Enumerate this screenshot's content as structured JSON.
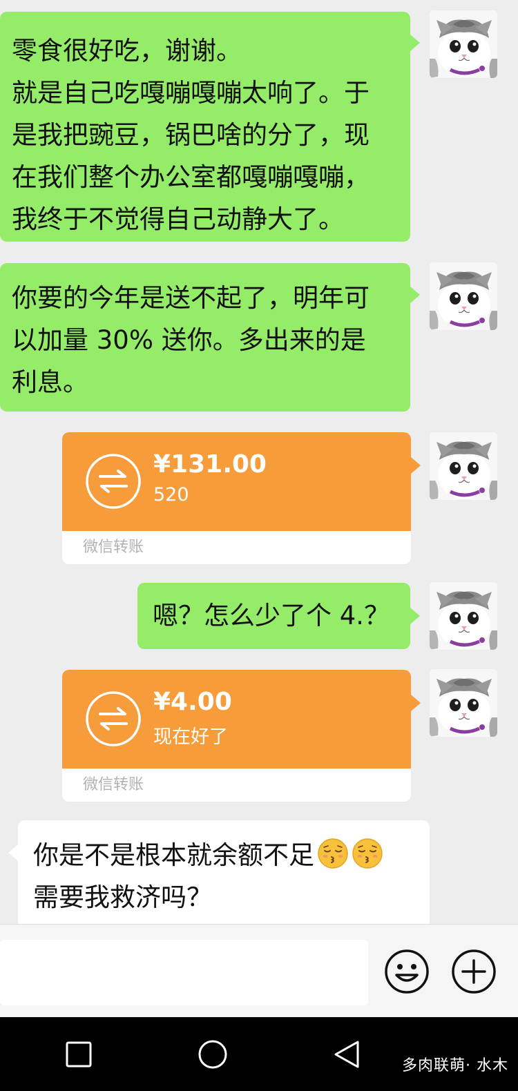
{
  "messages": {
    "m1": {
      "lines": [
        "零食很好吃，谢谢。",
        "就是自己吃嘎嘣嘎嘣太响了。于",
        "是我把豌豆，锅巴啥的分了，现",
        "在我们整个办公室都嘎嘣嘎嘣，",
        "我终于不觉得自己动静大了。"
      ]
    },
    "m2": {
      "lines": [
        "你要的今年是送不起了，明年可",
        "以加量 30% 送你。多出来的是",
        "利息。"
      ]
    },
    "t1": {
      "amount": "¥131.00",
      "note": "520",
      "label": "微信转账"
    },
    "m3": {
      "text": "嗯？怎么少了个 4.？"
    },
    "t2": {
      "amount": "¥4.00",
      "note": "现在好了",
      "label": "微信转账"
    },
    "m4": {
      "line1": "你是不是根本就余额不足",
      "line2": "需要我救济吗？",
      "emoji": "kissing-face-with-closed-eyes"
    }
  },
  "input_bar": {
    "emoji_button": "smiley-face-icon",
    "more_button": "plus-circle-icon"
  },
  "navbar": {
    "buttons": [
      "recent-apps-square-icon",
      "home-circle-icon",
      "back-triangle-icon"
    ],
    "watermark": "多肉联萌· 水木"
  },
  "colors": {
    "chat_bg": "#ededed",
    "green_bubble": "#95ec69",
    "transfer_orange": "#f79c3b",
    "nav_bg": "#000000"
  }
}
